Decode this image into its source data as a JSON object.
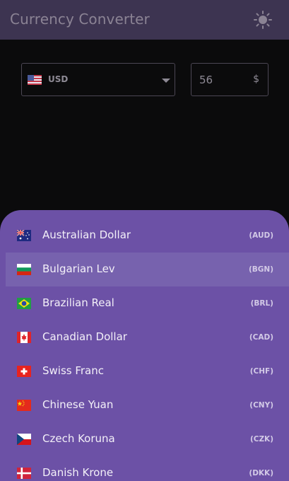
{
  "app": {
    "title": "Currency Converter",
    "theme_toggle_icon": "sun-icon"
  },
  "converter": {
    "selected_currency": "USD",
    "selected_flag_icon": "flag-us-icon",
    "amount_value": "56",
    "amount_suffix": "$"
  },
  "currency_list": [
    {
      "name": "Australian Dollar",
      "code": "(AUD)",
      "flag_icon": "flag-au-icon",
      "highlighted": false
    },
    {
      "name": "Bulgarian Lev",
      "code": "(BGN)",
      "flag_icon": "flag-bg-icon",
      "highlighted": true
    },
    {
      "name": "Brazilian Real",
      "code": "(BRL)",
      "flag_icon": "flag-br-icon",
      "highlighted": false
    },
    {
      "name": "Canadian Dollar",
      "code": "(CAD)",
      "flag_icon": "flag-ca-icon",
      "highlighted": false
    },
    {
      "name": "Swiss Franc",
      "code": "(CHF)",
      "flag_icon": "flag-ch-icon",
      "highlighted": false
    },
    {
      "name": "Chinese Yuan",
      "code": "(CNY)",
      "flag_icon": "flag-cn-icon",
      "highlighted": false
    },
    {
      "name": "Czech Koruna",
      "code": "(CZK)",
      "flag_icon": "flag-cz-icon",
      "highlighted": false
    },
    {
      "name": "Danish Krone",
      "code": "(DKK)",
      "flag_icon": "flag-dk-icon",
      "highlighted": false
    }
  ],
  "colors": {
    "header_bg": "#3d3451",
    "sheet_bg": "#6c51a6",
    "row_highlight": "#7762ae",
    "page_bg": "#0b0b0c"
  }
}
